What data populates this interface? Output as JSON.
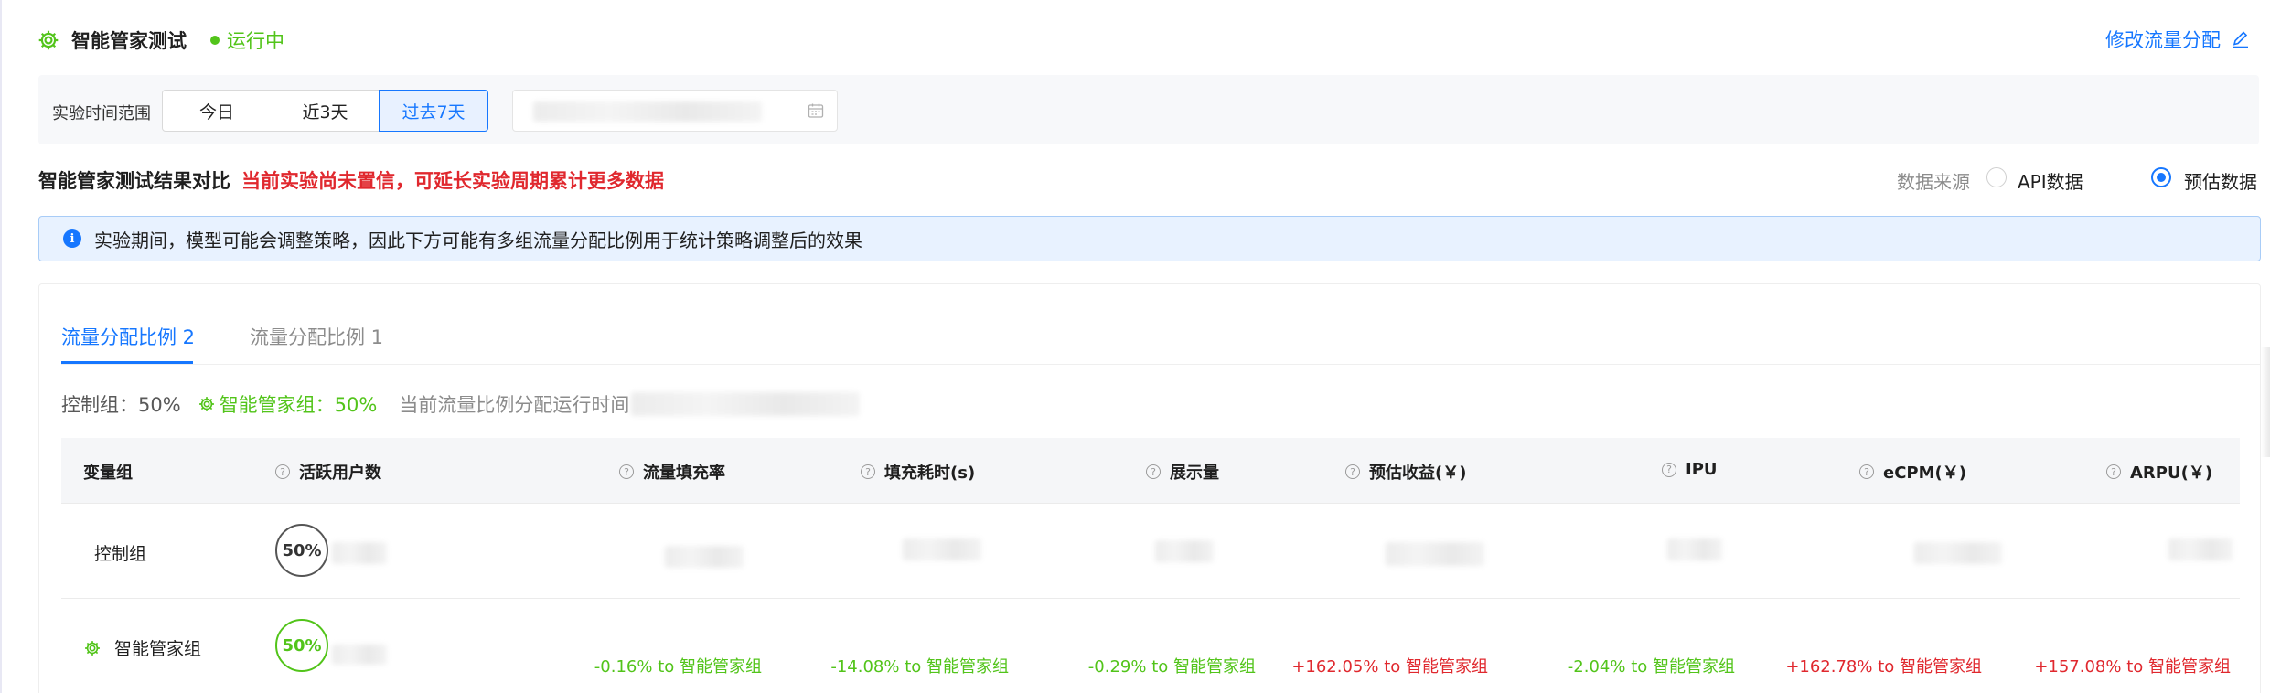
{
  "header": {
    "title": "智能管家测试",
    "status": "运行中",
    "status_color": "#52c41a",
    "edit_link": "修改流量分配"
  },
  "time_range": {
    "label": "实验时间范围",
    "options": [
      "今日",
      "近3天",
      "过去7天"
    ],
    "selected": "过去7天"
  },
  "section": {
    "title": "智能管家测试结果对比",
    "warning": "当前实验尚未置信，可延长实验周期累计更多数据",
    "data_source_label": "数据来源",
    "sources": [
      "API数据",
      "预估数据"
    ],
    "selected_source": "预估数据"
  },
  "info_banner": "实验期间，模型可能会调整策略，因此下方可能有多组流量分配比例用于统计策略调整后的效果",
  "tabs": [
    "流量分配比例 2",
    "流量分配比例 1"
  ],
  "active_tab": "流量分配比例 2",
  "ratio": {
    "control": "控制组：50%",
    "smart": "智能管家组：50%",
    "runtime_label": "当前流量比例分配运行时间"
  },
  "table": {
    "columns": [
      "变量组",
      "活跃用户数",
      "流量填充率",
      "填充耗时(s)",
      "展示量",
      "预估收益(￥)",
      "IPU",
      "eCPM(￥)",
      "ARPU(￥)"
    ],
    "rows": [
      {
        "name": "控制组",
        "share": "50%"
      },
      {
        "name": "智能管家组",
        "share": "50%",
        "deltas": [
          {
            "text": "-0.16% to 智能管家组",
            "trend": "negative"
          },
          {
            "text": "-14.08% to 智能管家组",
            "trend": "negative"
          },
          {
            "text": "-0.29% to 智能管家组",
            "trend": "negative"
          },
          {
            "text": "+162.05% to 智能管家组",
            "trend": "positive"
          },
          {
            "text": "-2.04% to 智能管家组",
            "trend": "negative"
          },
          {
            "text": "+162.78% to 智能管家组",
            "trend": "positive"
          },
          {
            "text": "+157.08% to 智能管家组",
            "trend": "positive"
          }
        ]
      }
    ]
  },
  "colors": {
    "accent": "#1677ff",
    "positive_delta": "#e0282e",
    "negative_delta": "#52c41a"
  },
  "icons": [
    "gear-icon",
    "edit-icon",
    "calendar-icon",
    "info-icon",
    "question-icon"
  ]
}
